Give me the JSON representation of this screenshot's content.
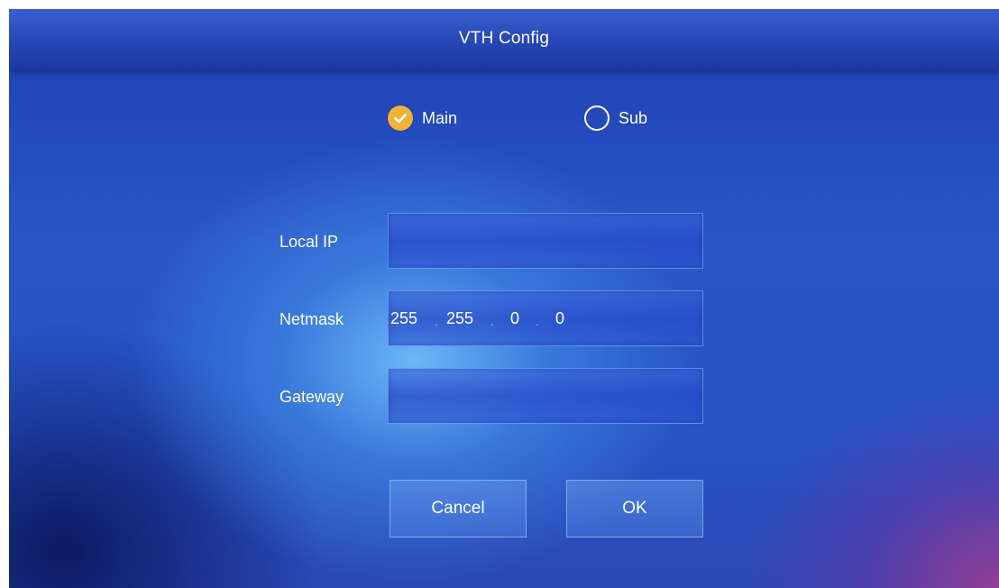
{
  "title": "VTH Config",
  "mode": {
    "options": [
      {
        "label": "Main",
        "checked": true
      },
      {
        "label": "Sub",
        "checked": false
      }
    ],
    "check_color": "#f2b23a"
  },
  "fields": {
    "local_ip": {
      "label": "Local IP",
      "value": ""
    },
    "netmask": {
      "label": "Netmask",
      "octets": [
        "255",
        "255",
        "0",
        "0"
      ],
      "separator": "."
    },
    "gateway": {
      "label": "Gateway",
      "value": ""
    }
  },
  "buttons": {
    "cancel": "Cancel",
    "ok": "OK"
  }
}
